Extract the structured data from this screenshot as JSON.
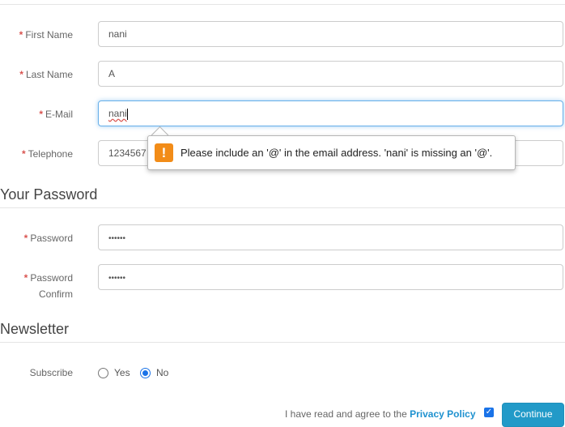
{
  "form": {
    "required_mark": "*",
    "first_name": {
      "label": "First Name",
      "value": "nani"
    },
    "last_name": {
      "label": "Last Name",
      "value": "A"
    },
    "email": {
      "label": "E-Mail",
      "value": "nani"
    },
    "telephone": {
      "label": "Telephone",
      "value": "1234567"
    }
  },
  "validation_tooltip": {
    "icon": "warning-icon",
    "icon_glyph": "!",
    "message": "Please include an '@' in the email address. 'nani' is missing an '@'."
  },
  "password_section": {
    "title": "Your Password",
    "password": {
      "label": "Password",
      "value": "••••••"
    },
    "confirm": {
      "label_line1": "Password",
      "label_line2": "Confirm",
      "value": "••••••"
    }
  },
  "newsletter_section": {
    "title": "Newsletter",
    "subscribe_label": "Subscribe",
    "options": [
      {
        "label": "Yes",
        "checked": false
      },
      {
        "label": "No",
        "checked": true
      }
    ]
  },
  "footer": {
    "agree_text": "I have read and agree to the ",
    "privacy_link": "Privacy Policy",
    "agree_checked": true,
    "continue_label": "Continue"
  },
  "colors": {
    "required": "#d9534f",
    "focus_border": "#66afe9",
    "warning": "#f28c18",
    "button": "#229ac8",
    "link": "#1e91cf"
  }
}
